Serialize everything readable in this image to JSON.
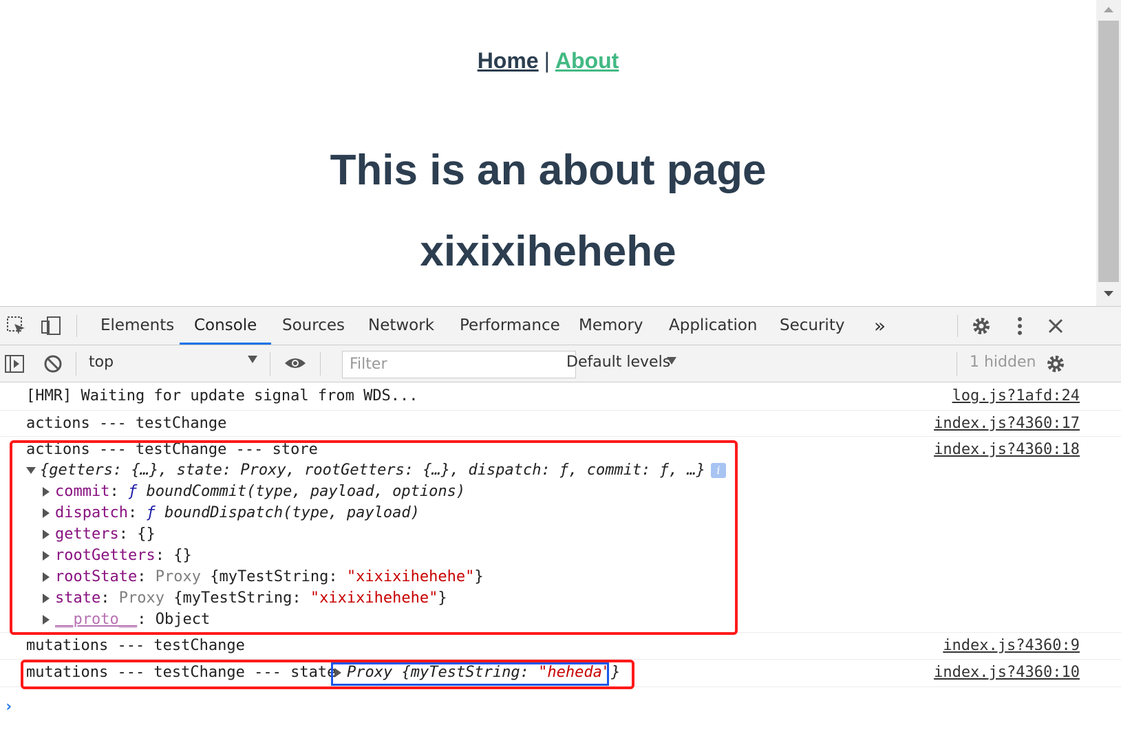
{
  "page": {
    "nav": {
      "home": "Home",
      "separator": "|",
      "about": "About"
    },
    "title": "This is an about page",
    "subtitle": "xixixihehehe"
  },
  "devtools": {
    "tabs": [
      "Elements",
      "Console",
      "Sources",
      "Network",
      "Performance",
      "Memory",
      "Application",
      "Security"
    ],
    "active_tab": "Console",
    "more_tabs": "»",
    "toolbar": {
      "context": "top",
      "filter_placeholder": "Filter",
      "levels": "Default levels",
      "hidden": "1 hidden"
    },
    "console": {
      "rows": [
        {
          "msg": "[HMR] Waiting for update signal from WDS...",
          "src": "log.js?1afd:24"
        },
        {
          "msg": "actions --- testChange",
          "src": "index.js?4360:17"
        },
        {
          "msg": "actions --- testChange --- store",
          "src": "index.js?4360:18"
        },
        {
          "msg": "mutations --- testChange",
          "src": "index.js?4360:9"
        },
        {
          "msg": "mutations --- testChange --- state",
          "src": "index.js?4360:10"
        }
      ],
      "store_summary": "{getters: {…}, state: Proxy, rootGetters: {…}, dispatch: ƒ, commit: ƒ, …}",
      "info_badge": "i",
      "tree": {
        "commit_key": "commit",
        "commit_f": "ƒ",
        "commit_val": "boundCommit(type, payload, options)",
        "dispatch_key": "dispatch",
        "dispatch_f": "ƒ",
        "dispatch_val": "boundDispatch(type, payload)",
        "getters_key": "getters",
        "getters_val": "{}",
        "rootGetters_key": "rootGetters",
        "rootGetters_val": "{}",
        "rootState_key": "rootState",
        "rootState_proxy": "Proxy",
        "rootState_obj_open": "{myTestString: ",
        "rootState_str": "\"xixixihehehe\"",
        "rootState_obj_close": "}",
        "state_key": "state",
        "state_proxy": "Proxy",
        "state_obj_open": "{myTestString: ",
        "state_str": "\"xixixihehehe\"",
        "state_obj_close": "}",
        "proto_key": "__proto__",
        "proto_val": "Object"
      },
      "state_inline": {
        "proxy": "Proxy",
        "open": "{myTestString: ",
        "str": "\"heheda\"",
        "close": "}"
      },
      "prompt": "›"
    }
  },
  "colors": {
    "text_dark": "#2c3e50",
    "vue_green": "#42b983",
    "highlight_red": "#ff1a1a",
    "highlight_blue": "#1a56e8",
    "tab_active": "#1a73e8"
  }
}
